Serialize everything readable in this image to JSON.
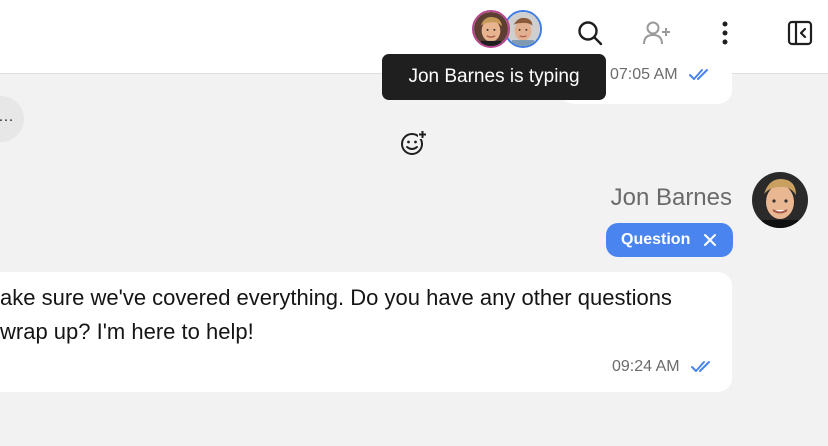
{
  "header": {
    "participants": [
      {
        "name": "Jon Barnes",
        "ring_color": "#b8478f"
      },
      {
        "name": "Second participant",
        "ring_color": "#3e7ce4"
      }
    ],
    "icons": [
      "search-icon",
      "add-user-icon",
      "more-vertical-icon",
      "collapse-panel-icon"
    ]
  },
  "tooltip": {
    "text": "Jon Barnes is typing"
  },
  "messages": {
    "previous": {
      "time": "07:05 AM",
      "status": "read"
    },
    "left_pill": {
      "glyph": "…"
    },
    "reaction_icon": "add-reaction-icon",
    "current": {
      "sender": "Jon Barnes",
      "tag": "Question",
      "lines": [
        "ake sure we've covered everything. Do you have any other questions",
        "wrap up? I'm here to help!"
      ],
      "time": "09:24 AM",
      "status": "read"
    }
  },
  "colors": {
    "accent": "#4a84ee",
    "tooltip_bg": "#1f1f1f"
  }
}
